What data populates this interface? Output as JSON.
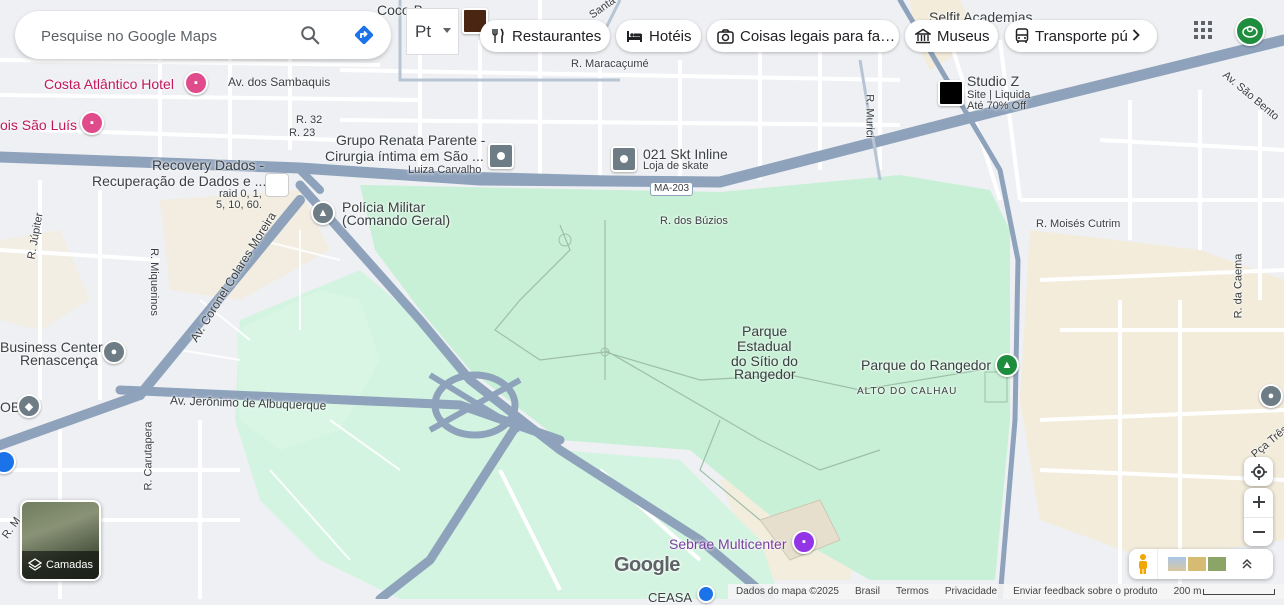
{
  "search": {
    "placeholder": "Pesquise no Google Maps"
  },
  "chips": [
    {
      "label": "Restaurantes",
      "icon": "fork-knife-icon"
    },
    {
      "label": "Hotéis",
      "icon": "bed-icon"
    },
    {
      "label": "Coisas legais para fa…",
      "icon": "camera-icon"
    },
    {
      "label": "Museus",
      "icon": "museum-icon"
    },
    {
      "label": "Transporte pú",
      "icon": "bus-icon"
    }
  ],
  "language_toggle": "Pt",
  "places": {
    "coco": "Coco B",
    "selfit": "Selfit Academias",
    "studio_z": "Studio Z",
    "studio_z_sub1": "Site | Liquida",
    "studio_z_sub2": "Até 70% Off",
    "costa_atlantico": "Costa Atlântico Hotel",
    "sao_luis": "ois São Luís",
    "grupo_renata_1": "Grupo Renata Parente -",
    "grupo_renata_2": "Cirurgia íntima em São ...",
    "grupo_renata_3": "Luiza Carvalho",
    "skt_inline": "021 Skt Inline",
    "skt_inline_sub": "Loja de skate",
    "recovery_1": "Recovery Dados -",
    "recovery_2": "Recuperação de Dados e ...",
    "recovery_3": "raid 0, 1,",
    "recovery_4": "5, 10, 60.",
    "policia_1": "Polícia Militar",
    "policia_2": "(Comando Geral)",
    "business_1": "Business Center",
    "business_2": "Renascença",
    "ob": "OB",
    "parque_estadual_1": "Parque",
    "parque_estadual_2": "Estadual",
    "parque_estadual_3": "do Sítio do",
    "parque_estadual_4": "Rangedor",
    "parque_rangedor": "Parque do Rangedor",
    "alto_calhau": "ALTO DO CALHAU",
    "sebrae": "Sebrae Multicenter",
    "ceasa": "CEASA"
  },
  "roads": {
    "sambaquis": "Av. dos Sambaquis",
    "maracacume": "R. Maracaçumé",
    "r32": "R. 32",
    "r23": "R. 23",
    "ma203": "MA-203",
    "buzios": "R. dos Búzios",
    "murici": "R. Murici",
    "sao_bento": "Av. São Bento",
    "moises": "R. Moisés Cutrim",
    "jupiter": "R. Júpiter",
    "miquerinos": "R. Miquerinos",
    "colares": "Av. Coronel Colares Moreira",
    "jeronimo": "Av. Jerônimo de Albuquerque",
    "carutapera": "R. Carutapera",
    "caema": "R. da Caema",
    "paa_tres": "Pça Três",
    "santa": "Santa",
    "rm": "R. M"
  },
  "layers_button": "Camadas",
  "google_logo": "Google",
  "footer": {
    "data": "Dados do mapa ©2025",
    "country": "Brasil",
    "terms": "Termos",
    "privacy": "Privacidade",
    "feedback": "Enviar feedback sobre o produto",
    "scale": "200 m"
  },
  "colors": {
    "park": "#c8f0d6",
    "arterial": "#8ea2bb",
    "street": "#ffffff",
    "land": "#eef0f3",
    "sand": "#f3ecdb",
    "accent_blue": "#1a73e8"
  }
}
